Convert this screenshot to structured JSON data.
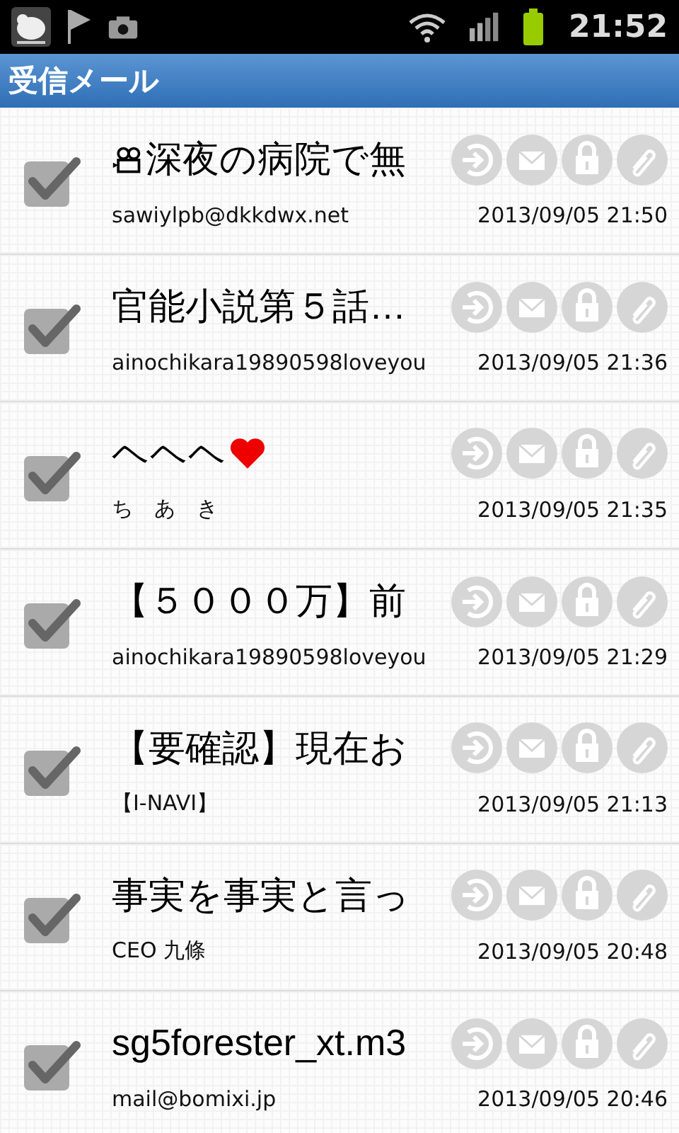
{
  "status_bar": {
    "time": "21:52"
  },
  "title": "受信メール",
  "mails": [
    {
      "kind": "video",
      "subject": "深夜の病院で無",
      "sender": "sawiylpb@dkkdwx.net",
      "date": "2013/09/05 21:50",
      "checked": true,
      "replied": false,
      "opened": false,
      "locked": false,
      "attached": false
    },
    {
      "kind": "plain",
      "subject": "官能小説第５話…",
      "sender": "ainochikara19890598loveyou",
      "date": "2013/09/05 21:36",
      "checked": true,
      "replied": false,
      "opened": false,
      "locked": false,
      "attached": false
    },
    {
      "kind": "heart",
      "subject": "ヘヘヘ",
      "sender": "ち　あ　き",
      "date": "2013/09/05 21:35",
      "checked": true,
      "replied": false,
      "opened": false,
      "locked": false,
      "attached": false
    },
    {
      "kind": "plain",
      "subject": "【５０００万】前",
      "sender": "ainochikara19890598loveyou",
      "date": "2013/09/05 21:29",
      "checked": true,
      "replied": false,
      "opened": false,
      "locked": false,
      "attached": false
    },
    {
      "kind": "plain",
      "subject": "【要確認】現在お",
      "sender": "【I-NAVI】",
      "date": "2013/09/05 21:13",
      "checked": true,
      "replied": false,
      "opened": false,
      "locked": false,
      "attached": false
    },
    {
      "kind": "plain",
      "subject": "事実を事実と言っ",
      "sender": "CEO 九條",
      "date": "2013/09/05 20:48",
      "checked": true,
      "replied": false,
      "opened": false,
      "locked": false,
      "attached": false
    },
    {
      "kind": "plain",
      "subject": "sg5forester_xt.m3",
      "sender": "mail@bomixi.jp",
      "date": "2013/09/05 20:46",
      "checked": true,
      "replied": false,
      "opened": false,
      "locked": false,
      "attached": false
    }
  ]
}
